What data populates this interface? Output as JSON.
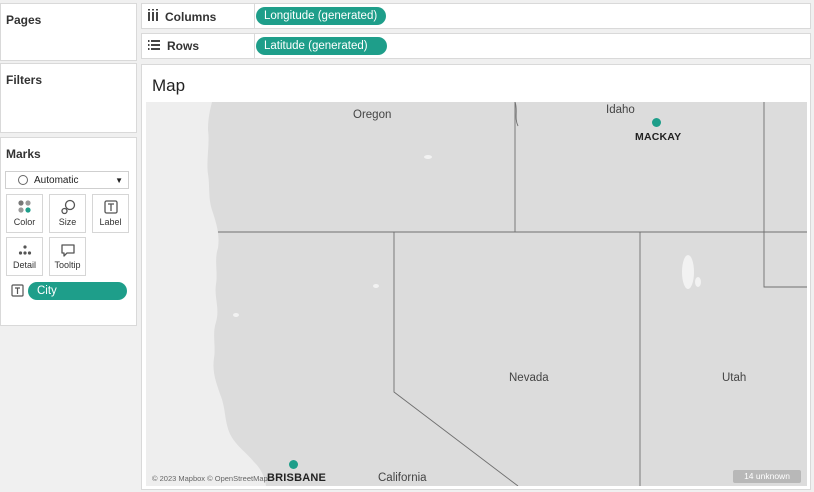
{
  "left_panel": {
    "pages_title": "Pages",
    "filters_title": "Filters",
    "marks": {
      "title": "Marks",
      "mark_type": "Automatic",
      "buttons": [
        {
          "label": "Color",
          "icon": "color-dots-icon"
        },
        {
          "label": "Size",
          "icon": "size-icon"
        },
        {
          "label": "Label",
          "icon": "label-icon"
        },
        {
          "label": "Detail",
          "icon": "detail-icon"
        },
        {
          "label": "Tooltip",
          "icon": "tooltip-icon"
        }
      ],
      "field_pill": "City"
    }
  },
  "shelves": {
    "columns_label": "Columns",
    "columns_pill": "Longitude (generated)",
    "rows_label": "Rows",
    "rows_pill": "Latitude (generated)"
  },
  "view": {
    "title": "Map",
    "region_labels": [
      "Oregon",
      "Idaho",
      "Nevada",
      "Utah",
      "California"
    ],
    "cities": [
      {
        "name": "MACKAY",
        "color": "#1e9e8a"
      },
      {
        "name": "BRISBANE",
        "color": "#1e9e8a"
      }
    ],
    "attribution": "© 2023 Mapbox © OpenStreetMap",
    "unknown_badge": "14 unknown"
  },
  "colors": {
    "accent": "#1e9e8a",
    "map_land": "#dcdcdc",
    "map_water": "#eeeeee"
  }
}
